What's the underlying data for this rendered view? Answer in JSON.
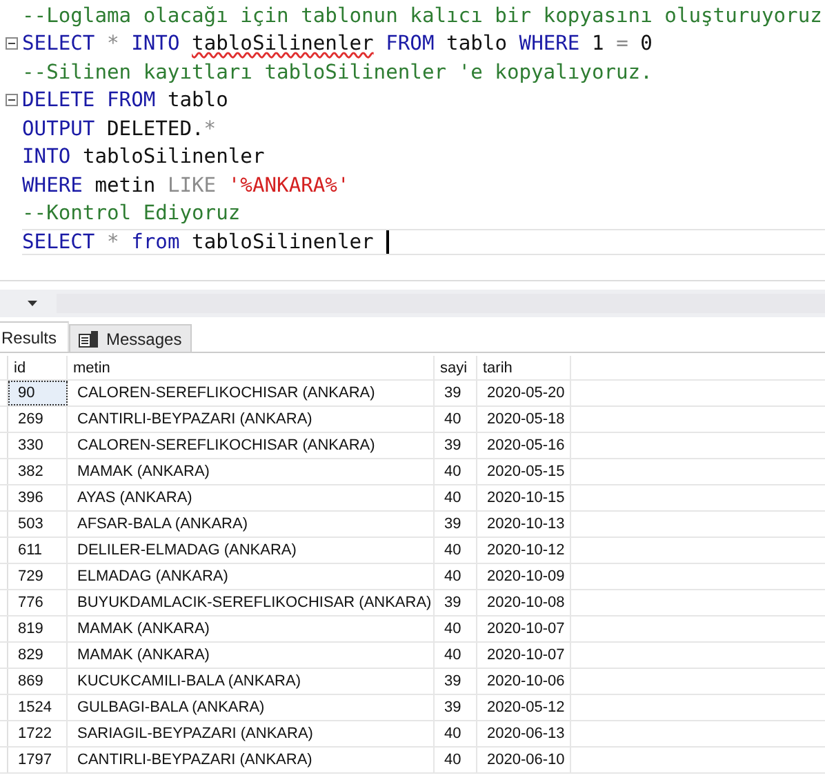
{
  "editor": {
    "lines": [
      {
        "tokens": [
          {
            "kind": "comment",
            "text": "--Loglama olacağı için tablonun kalıcı bir kopyasını oluşturuyoruz"
          }
        ]
      },
      {
        "fold": true,
        "tokens": [
          {
            "kind": "keyword",
            "text": "SELECT "
          },
          {
            "kind": "operator",
            "text": "* "
          },
          {
            "kind": "keyword",
            "text": "INTO "
          },
          {
            "kind": "error",
            "text": "tabloSilinenler"
          },
          {
            "kind": "keyword",
            "text": " FROM"
          },
          {
            "kind": "plain",
            "text": " tablo "
          },
          {
            "kind": "keyword",
            "text": "WHERE"
          },
          {
            "kind": "plain",
            "text": " 1 "
          },
          {
            "kind": "operator",
            "text": "= "
          },
          {
            "kind": "plain",
            "text": "0"
          }
        ]
      },
      {
        "tokens": [
          {
            "kind": "comment",
            "text": "--Silinen kayıtları tabloSilinenler 'e kopyalıyoruz."
          }
        ]
      },
      {
        "fold": true,
        "tokens": [
          {
            "kind": "keyword",
            "text": "DELETE FROM"
          },
          {
            "kind": "plain",
            "text": " tablo"
          }
        ]
      },
      {
        "tokens": [
          {
            "kind": "keyword",
            "text": "OUTPUT"
          },
          {
            "kind": "plain",
            "text": " DELETED."
          },
          {
            "kind": "operator",
            "text": "*"
          }
        ]
      },
      {
        "tokens": [
          {
            "kind": "keyword",
            "text": "INTO"
          },
          {
            "kind": "plain",
            "text": " tabloSilinenler"
          }
        ]
      },
      {
        "tokens": [
          {
            "kind": "keyword",
            "text": "WHERE"
          },
          {
            "kind": "plain",
            "text": " metin "
          },
          {
            "kind": "operator",
            "text": "LIKE "
          },
          {
            "kind": "string",
            "text": "'%ANKARA%'"
          }
        ]
      },
      {
        "tokens": [
          {
            "kind": "comment",
            "text": "--Kontrol Ediyoruz"
          }
        ]
      },
      {
        "cursor": true,
        "tokens": [
          {
            "kind": "keyword",
            "text": "SELECT "
          },
          {
            "kind": "operator",
            "text": "* "
          },
          {
            "kind": "keyword",
            "text": "from"
          },
          {
            "kind": "plain",
            "text": " tabloSilinenler "
          }
        ]
      }
    ]
  },
  "tabs": [
    {
      "label": "Results",
      "selected": true
    },
    {
      "label": "Messages",
      "selected": false
    }
  ],
  "table": {
    "columns": [
      "id",
      "metin",
      "sayi",
      "tarih"
    ],
    "rows": [
      {
        "cells": [
          "90",
          "CALOREN-SEREFLIKOCHISAR (ANKARA)",
          "39",
          "2020-05-20"
        ],
        "focused": true
      },
      {
        "cells": [
          "269",
          "CANTIRLI-BEYPAZARI (ANKARA)",
          "40",
          "2020-05-18"
        ],
        "focused": false
      },
      {
        "cells": [
          "330",
          "CALOREN-SEREFLIKOCHISAR (ANKARA)",
          "39",
          "2020-05-16"
        ],
        "focused": false
      },
      {
        "cells": [
          "382",
          "MAMAK (ANKARA)",
          "40",
          "2020-05-15"
        ],
        "focused": false
      },
      {
        "cells": [
          "396",
          "AYAS (ANKARA)",
          "40",
          "2020-10-15"
        ],
        "focused": false
      },
      {
        "cells": [
          "503",
          "AFSAR-BALA (ANKARA)",
          "39",
          "2020-10-13"
        ],
        "focused": false
      },
      {
        "cells": [
          "611",
          "DELILER-ELMADAG (ANKARA)",
          "40",
          "2020-10-12"
        ],
        "focused": false
      },
      {
        "cells": [
          "729",
          "ELMADAG (ANKARA)",
          "40",
          "2020-10-09"
        ],
        "focused": false
      },
      {
        "cells": [
          "776",
          "BUYUKDAMLACIK-SEREFLIKOCHISAR (ANKARA)",
          "39",
          "2020-10-08"
        ],
        "focused": false
      },
      {
        "cells": [
          "819",
          "MAMAK (ANKARA)",
          "40",
          "2020-10-07"
        ],
        "focused": false
      },
      {
        "cells": [
          "829",
          "MAMAK (ANKARA)",
          "40",
          "2020-10-07"
        ],
        "focused": false
      },
      {
        "cells": [
          "869",
          "KUCUKCAMILI-BALA (ANKARA)",
          "39",
          "2020-10-06"
        ],
        "focused": false
      },
      {
        "cells": [
          "1524",
          "GULBAGI-BALA (ANKARA)",
          "39",
          "2020-05-12"
        ],
        "focused": false
      },
      {
        "cells": [
          "1722",
          "SARIAGIL-BEYPAZARI (ANKARA)",
          "40",
          "2020-06-13"
        ],
        "focused": false
      },
      {
        "cells": [
          "1797",
          "CANTIRLI-BEYPAZARI (ANKARA)",
          "40",
          "2020-06-10"
        ],
        "focused": false
      }
    ]
  }
}
